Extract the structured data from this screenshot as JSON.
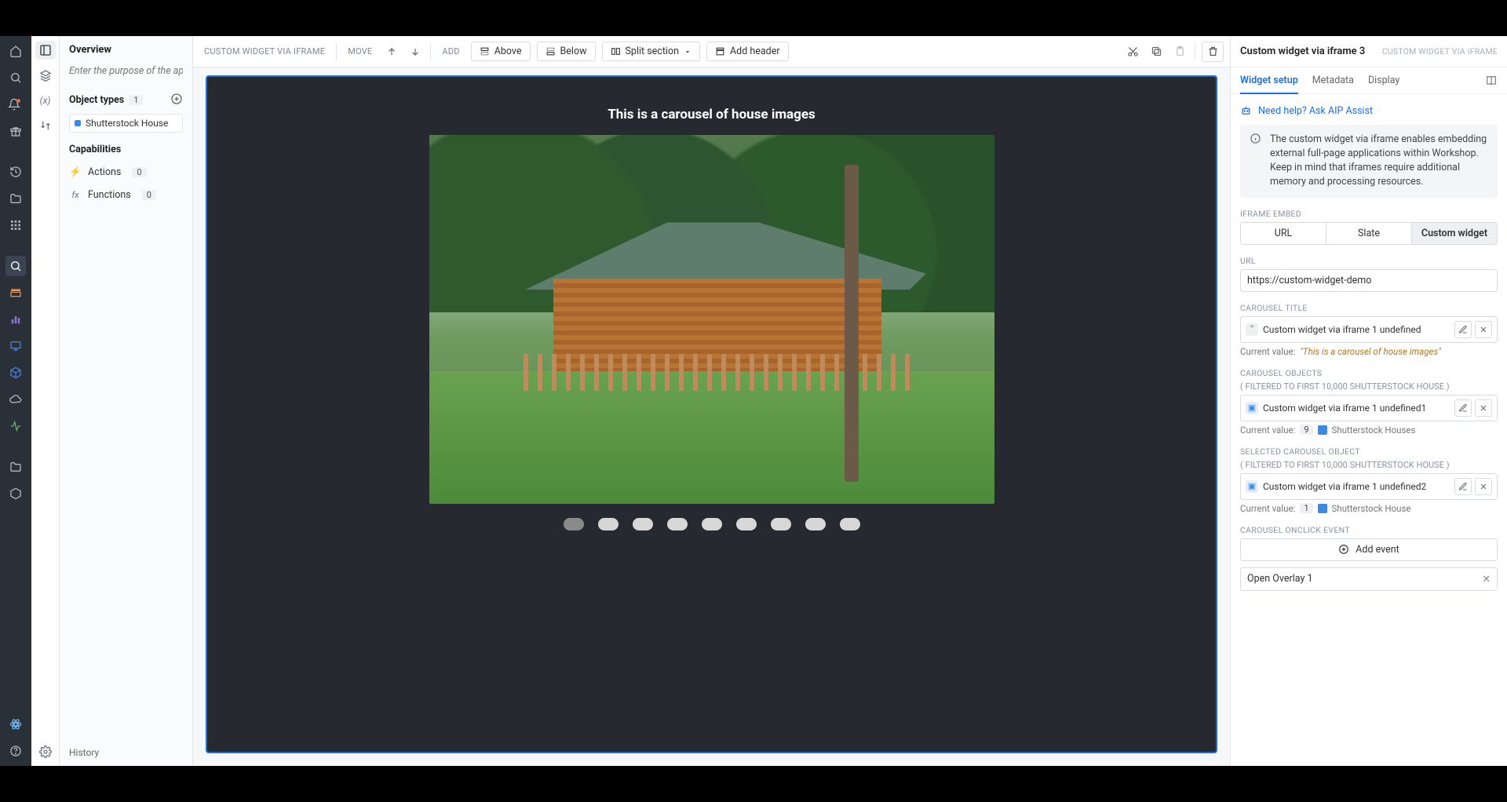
{
  "rail_icons": [
    "home",
    "search",
    "bell",
    "gift",
    "history",
    "folder-open",
    "apps"
  ],
  "rail_bottom_icons": [
    "logo",
    "help"
  ],
  "rail2_icons": [
    "panel",
    "layers",
    "var",
    "swap",
    "folder",
    "grid",
    "gear"
  ],
  "rail_mid_icons": [
    "magnify",
    "table",
    "chart",
    "monitor",
    "cube",
    "cloud",
    "pulse",
    "folder2",
    "box"
  ],
  "overview": {
    "title": "Overview",
    "purpose_placeholder": "Enter the purpose of the app",
    "object_types_label": "Object types",
    "object_types_count": "1",
    "object_types_items": [
      "Shutterstock House"
    ],
    "capabilities_label": "Capabilities",
    "capabilities": [
      {
        "icon": "⚡",
        "label": "Actions",
        "count": "0"
      },
      {
        "icon": "fx",
        "label": "Functions",
        "count": "0"
      }
    ],
    "history_label": "History"
  },
  "toolbar": {
    "context": "CUSTOM WIDGET VIA IFRAME",
    "move_label": "MOVE",
    "add_label": "ADD",
    "above": "Above",
    "below": "Below",
    "split": "Split section",
    "add_header": "Add header"
  },
  "carousel": {
    "title": "This is a carousel of house images",
    "dot_count": 9,
    "active_dot": 0
  },
  "right": {
    "title": "Custom widget via iframe 3",
    "subtitle": "CUSTOM WIDGET VIA IFRAME",
    "tabs": [
      "Widget setup",
      "Metadata",
      "Display"
    ],
    "active_tab": 0,
    "assist": "Need help? Ask AIP Assist",
    "info": "The custom widget via iframe enables embedding external full-page applications within Workshop. Keep in mind that iframes require additional memory and processing resources.",
    "iframe_embed_label": "IFRAME EMBED",
    "seg": [
      "URL",
      "Slate",
      "Custom widget"
    ],
    "seg_active": 2,
    "url_label": "URL",
    "url_value": "https://custom-widget-demo",
    "carousel_title_label": "CAROUSEL TITLE",
    "carousel_title_field": "Custom widget via iframe 1 undefined",
    "current_value_label": "Current value:",
    "carousel_title_current": "\"This is a carousel of house images\"",
    "carousel_objects_label": "CAROUSEL OBJECTS",
    "carousel_objects_filter": "( FILTERED TO FIRST 10,000",
    "carousel_objects_type": "SHUTTERSTOCK HOUSE )",
    "carousel_objects_field": "Custom widget via iframe 1 undefined1",
    "carousel_objects_count": "9",
    "carousel_objects_name": "Shutterstock Houses",
    "selected_label": "SELECTED CAROUSEL OBJECT",
    "selected_filter": "( FILTERED TO FIRST 10,000",
    "selected_type": "SHUTTERSTOCK HOUSE )",
    "selected_field": "Custom widget via iframe 1 undefined2",
    "selected_count": "1",
    "selected_name": "Shutterstock House",
    "onclick_label": "CAROUSEL ONCLICK EVENT",
    "add_event": "Add event",
    "event_name": "Open Overlay 1"
  }
}
